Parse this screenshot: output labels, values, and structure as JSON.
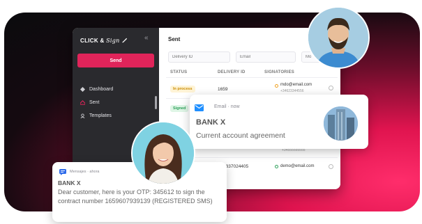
{
  "sidebar": {
    "logo_text": "CLICK &",
    "logo_script": "Sign",
    "send_label": "Send",
    "items": [
      {
        "label": "Dashboard",
        "icon": "dashboard-icon"
      },
      {
        "label": "Sent",
        "icon": "sent-icon"
      },
      {
        "label": "Templates",
        "icon": "templates-icon"
      }
    ]
  },
  "main": {
    "title": "Sent",
    "filters": {
      "delivery_id": "Delivery ID",
      "email": "Email",
      "mobile": "Mo"
    },
    "columns": [
      "STATUS",
      "DELIVERY ID",
      "SIGNATORIES"
    ],
    "rows": [
      {
        "status": "In process",
        "delivery_id": "1659",
        "email": "mdo@email.com",
        "phone": "+34623344556"
      },
      {
        "status": "Signed",
        "delivery_id": "",
        "email": "",
        "phone": ""
      },
      {
        "status": "",
        "delivery_id": "",
        "email": "",
        "phone": "+34555555555"
      },
      {
        "status": "",
        "delivery_id": "3337024405",
        "email": "demo@email.com",
        "phone": ""
      }
    ]
  },
  "email_notification": {
    "source": "Email · now",
    "sender": "BANK X",
    "subject": "Current account agreement"
  },
  "sms_notification": {
    "source": "Mensajes · ahora",
    "sender": "BANK X",
    "body": "Dear customer, here is your OTP: 345612 to sign the contract number 1659607939139 (REGISTERED SMS)"
  },
  "colors": {
    "accent": "#e0245a",
    "sidebar": "#2a2a2e",
    "email_icon": "#1f8fff",
    "sms_icon": "#2f6bea"
  }
}
